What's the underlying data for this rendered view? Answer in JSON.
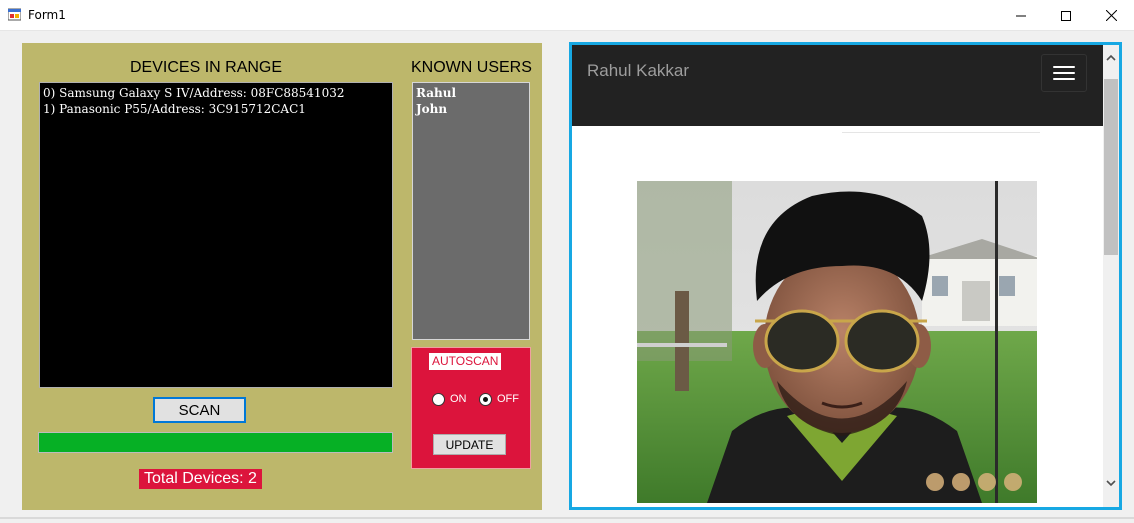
{
  "window": {
    "title": "Form1",
    "icon": "form-app-icon"
  },
  "left_panel": {
    "devices_label": "DEVICES IN RANGE",
    "known_users_label": "KNOWN USERS",
    "devices": [
      "0) Samsung Galaxy S IV/Address: 08FC88541032",
      "1) Panasonic P55/Address: 3C915712CAC1"
    ],
    "known_users": [
      "Rahul",
      "John"
    ],
    "scan_label": "SCAN",
    "scan_progress": 1.0,
    "total_devices_text": "Total Devices: 2",
    "autoscan": {
      "label": "AUTOSCAN",
      "on_label": "ON",
      "off_label": "OFF",
      "selected": "OFF",
      "update_label": "UPDATE"
    }
  },
  "browser": {
    "brand": "Rahul Kakkar",
    "menu_icon": "hamburger-menu-icon",
    "photo": "profile-photo"
  },
  "colors": {
    "panel_bg": "#bdb76b",
    "accent_red": "#dc143c",
    "progress_green": "#06b025",
    "browser_border": "#17a8e3",
    "navbar": "#222222"
  }
}
